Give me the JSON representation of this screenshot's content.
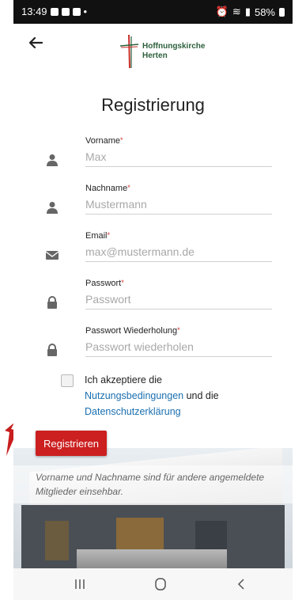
{
  "status": {
    "time": "13:49",
    "battery": "58%"
  },
  "logo": {
    "line1": "Hoffnungskirche",
    "line2": "Herten"
  },
  "title": "Registrierung",
  "fields": [
    {
      "label": "Vorname",
      "required_mark": "*",
      "placeholder": "Max",
      "icon": "person-icon"
    },
    {
      "label": "Nachname",
      "required_mark": "*",
      "placeholder": "Mustermann",
      "icon": "person-icon"
    },
    {
      "label": "Email",
      "required_mark": "*",
      "placeholder": "max@mustermann.de",
      "icon": "envelope-icon"
    },
    {
      "label": "Passwort",
      "required_mark": "*",
      "placeholder": "Passwort",
      "icon": "lock-icon"
    },
    {
      "label": "Passwort Wiederholung",
      "required_mark": "*",
      "placeholder": "Passwort wiederholen",
      "icon": "lock-icon"
    }
  ],
  "terms": {
    "prefix": "Ich akzeptiere die",
    "link1": "Nutzungsbedingungen",
    "middle": "und die",
    "link2": "Datenschutzerklärung",
    "checked": false
  },
  "register_button": "Registrieren",
  "note": "Vorname und Nachname sind für andere angemeldete Mitglieder einsehbar.",
  "colors": {
    "accent": "#cc1f1f",
    "link": "#1a6fb0",
    "logo_green": "#2c5f3b",
    "required": "#d32f2f"
  }
}
